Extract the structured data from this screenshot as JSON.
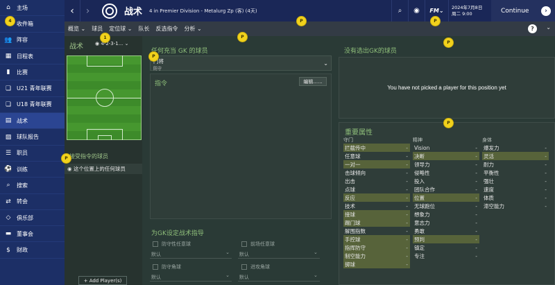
{
  "sidebar": {
    "items": [
      {
        "label": "主场",
        "icon": "home-icon",
        "glyph": "⌂"
      },
      {
        "label": "收件箱",
        "icon": "inbox-icon",
        "glyph": "✉"
      },
      {
        "label": "阵容",
        "icon": "squad-icon",
        "glyph": "👥"
      },
      {
        "label": "日程表",
        "icon": "calendar-icon",
        "glyph": "▦"
      },
      {
        "label": "比赛",
        "icon": "match-icon",
        "glyph": "▮"
      },
      {
        "label": "U21 青年联赛",
        "icon": "u21-icon",
        "glyph": "❏"
      },
      {
        "label": "U18 青年联赛",
        "icon": "u18-icon",
        "glyph": "❏"
      },
      {
        "label": "战术",
        "icon": "tactics-icon",
        "glyph": "▤"
      },
      {
        "label": "球队报告",
        "icon": "report-icon",
        "glyph": "▨"
      },
      {
        "label": "职员",
        "icon": "staff-icon",
        "glyph": "☰"
      },
      {
        "label": "训练",
        "icon": "training-icon",
        "glyph": "⚽"
      },
      {
        "label": "搜索",
        "icon": "search-icon",
        "glyph": "⌕"
      },
      {
        "label": "转会",
        "icon": "transfer-icon",
        "glyph": "⇄"
      },
      {
        "label": "俱乐部",
        "icon": "club-icon",
        "glyph": "◇"
      },
      {
        "label": "董事会",
        "icon": "board-icon",
        "glyph": "▬"
      },
      {
        "label": "财政",
        "icon": "finance-icon",
        "glyph": "$"
      }
    ],
    "inbox_badge": "4"
  },
  "header": {
    "back_glyph": "‹",
    "forward_glyph": "›",
    "title": "战术",
    "subtitle": "4 in Premier Division - Metalurg Zp (客) (4天)",
    "search_glyph": "⌕",
    "globe_glyph": "◉",
    "fm_label": "FM",
    "date_line1": "2024年7月8日",
    "date_line2": "周二 9:00",
    "continue_label": "Continue",
    "continue_glyph": "›"
  },
  "toolbar": {
    "menus": [
      "概览 ⌄",
      "球员",
      "定位球 ⌄",
      "队长",
      "反选指令",
      "分析 ⌄"
    ],
    "help_glyph": "?",
    "dropdown_glyph": "⌄"
  },
  "tactic": {
    "label": "战术",
    "formation": "4-2-3-1...",
    "instructed_players_title": "接受指令的球员",
    "any_player": "这个位置上的任何球员",
    "add_player": "+ Add Player(s)"
  },
  "gk_panel": {
    "title": "任何充当 GK 的球员",
    "role": "门将",
    "duty": "防守",
    "instructions_title": "指令",
    "edit_label": "编辑......",
    "set_piece_title": "为GK设定战术指导",
    "rows": [
      {
        "left_check": "防守性任意球",
        "right_check": "前场任意球"
      },
      {
        "left_check": "防守角球",
        "right_check": "进攻角球"
      }
    ],
    "default_label": "默认"
  },
  "no_gk": {
    "title": "没有选出GK的球员",
    "message": "You have not picked a player for this position yet"
  },
  "attributes": {
    "title": "重要属性",
    "columns": [
      {
        "heading": "守门",
        "items": [
          {
            "label": "拦截传中",
            "hl": true
          },
          {
            "label": "任意球",
            "hl": false
          },
          {
            "label": "一对一",
            "hl": true
          },
          {
            "label": "击球倾向",
            "hl": false
          },
          {
            "label": "出击",
            "hl": false
          },
          {
            "label": "点球",
            "hl": false
          },
          {
            "label": "反应",
            "hl": true
          },
          {
            "label": "技术",
            "hl": false
          },
          {
            "label": "接球",
            "hl": true
          },
          {
            "label": "踢门球",
            "hl": true
          },
          {
            "label": "解围指数",
            "hl": false
          },
          {
            "label": "手控球",
            "hl": true
          },
          {
            "label": "指挥防守",
            "hl": true
          },
          {
            "label": "制空能力",
            "hl": true
          },
          {
            "label": "掷球",
            "hl": true
          }
        ]
      },
      {
        "heading": "精神",
        "items": [
          {
            "label": "Vision",
            "hl": false
          },
          {
            "label": "决断",
            "hl": true
          },
          {
            "label": "领导力",
            "hl": false
          },
          {
            "label": "侵略性",
            "hl": false
          },
          {
            "label": "投入",
            "hl": false
          },
          {
            "label": "团队合作",
            "hl": false
          },
          {
            "label": "位置",
            "hl": true
          },
          {
            "label": "无球跑位",
            "hl": false
          },
          {
            "label": "想象力",
            "hl": false
          },
          {
            "label": "意志力",
            "hl": false
          },
          {
            "label": "勇敢",
            "hl": false
          },
          {
            "label": "预判",
            "hl": true
          },
          {
            "label": "镇定",
            "hl": false
          },
          {
            "label": "专注",
            "hl": false
          }
        ]
      },
      {
        "heading": "身体",
        "items": [
          {
            "label": "爆发力",
            "hl": false
          },
          {
            "label": "灵活",
            "hl": true
          },
          {
            "label": "耐力",
            "hl": false
          },
          {
            "label": "平衡性",
            "hl": false
          },
          {
            "label": "强壮",
            "hl": false
          },
          {
            "label": "速度",
            "hl": false
          },
          {
            "label": "体质",
            "hl": false
          },
          {
            "label": "滞空能力",
            "hl": false
          }
        ]
      }
    ],
    "dash": "-"
  },
  "markers": {
    "glyph": "P",
    "one": "1"
  }
}
